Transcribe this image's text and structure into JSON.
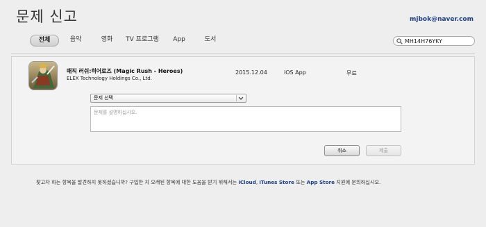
{
  "page": {
    "title": "문제 신고"
  },
  "user": {
    "email": "mjbok@naver.com"
  },
  "tabs": [
    {
      "label": "전체",
      "active": true
    },
    {
      "label": "음악",
      "active": false
    },
    {
      "label": "영화",
      "active": false
    },
    {
      "label": "TV 프로그램",
      "active": false
    },
    {
      "label": "App",
      "active": false
    },
    {
      "label": "도서",
      "active": false
    }
  ],
  "search": {
    "value": "MH14H76YKY",
    "icon": "search-icon"
  },
  "item": {
    "name": "매직 러쉬:히어로즈 (Magic Rush - Heroes)",
    "developer": "ELEX Technology Holdings Co., Ltd.",
    "date": "2015.12.04",
    "type": "iOS App",
    "price": "무료"
  },
  "form": {
    "select_label": "문제 선택",
    "textarea_placeholder": "문제를 설명하십시오.",
    "cancel_label": "취소",
    "submit_label": "제출"
  },
  "footer": {
    "prefix": "찾고자 하는 항목을 발견하지 못하셨습니까? 구입한 지 오래된 항목에 대한 도움을 받기 위해서는 ",
    "link1": "iCloud",
    "sep1": ", ",
    "link2": "iTunes Store",
    "sep2": " 또는 ",
    "link3": "App Store",
    "suffix": " 지원에 문의하십시오."
  },
  "colors": {
    "link": "#1b3f86",
    "background": "#eeeeee"
  }
}
